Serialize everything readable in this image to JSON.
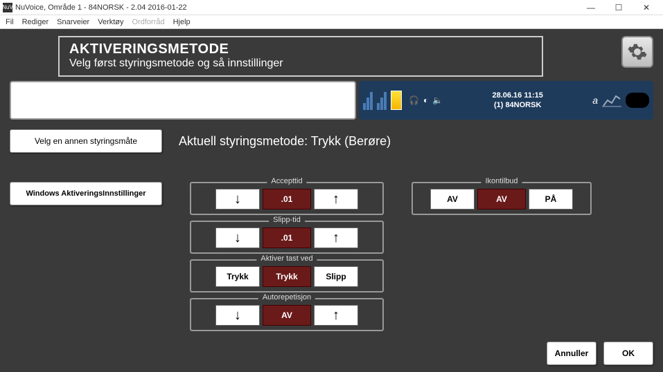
{
  "window": {
    "title": "NuVoice, Område 1 - 84NORSK - 2.04 2016-01-22",
    "app_abbrev": "NuV"
  },
  "menu": {
    "fil": "Fil",
    "rediger": "Rediger",
    "snarveier": "Snarveier",
    "verktoy": "Verktøy",
    "ordforrad": "Ordforråd",
    "hjelp": "Hjelp"
  },
  "header": {
    "title": "AKTIVERINGSMETODE",
    "subtitle": "Velg først styringsmetode og så innstillinger"
  },
  "status": {
    "datetime": "28.06.16 11:15",
    "area": "(1) 84NORSK",
    "a_label": "a"
  },
  "mode": {
    "choose_other": "Velg en annen styringsmåte",
    "current_label": "Aktuell styringsmetode: Trykk (Berøre)"
  },
  "buttons": {
    "windows_activation": "Windows AktiveringsInnstillinger",
    "cancel": "Annuller",
    "ok": "OK"
  },
  "groups": {
    "accept": {
      "label": "Accepttid",
      "value": ".01"
    },
    "release": {
      "label": "Slipp-tid",
      "value": ".01"
    },
    "activate": {
      "label": "Aktiver tast ved",
      "left": "Trykk",
      "value": "Trykk",
      "right": "Slipp"
    },
    "autorep": {
      "label": "Autorepetisjon",
      "value": "AV"
    },
    "iconoffer": {
      "label": "Ikontilbud",
      "left": "AV",
      "value": "AV",
      "right": "PÅ"
    }
  },
  "icons": {
    "gear": "gear-icon",
    "arrow_down": "↓",
    "arrow_up": "↑"
  }
}
